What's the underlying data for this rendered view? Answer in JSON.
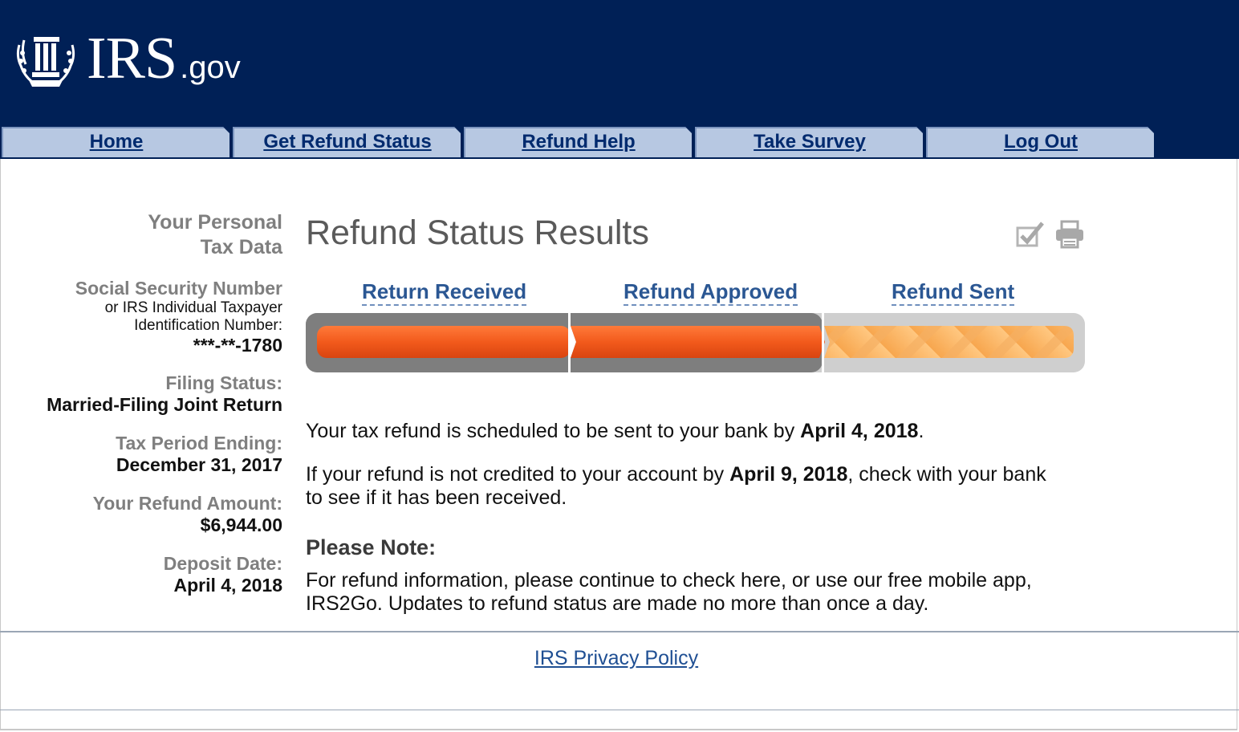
{
  "header": {
    "logo_main": "IRS",
    "logo_suffix": ".gov",
    "logo_icon": "irs-eagle-icon"
  },
  "nav": [
    {
      "label": "Home"
    },
    {
      "label": "Get Refund Status"
    },
    {
      "label": "Refund Help"
    },
    {
      "label": "Take Survey"
    },
    {
      "label": "Log Out"
    }
  ],
  "sidebar": {
    "heading_line1": "Your Personal",
    "heading_line2": "Tax Data",
    "ssn_label": "Social Security Number",
    "ssn_sub1": "or IRS Individual Taxpayer",
    "ssn_sub2": "Identification Number:",
    "ssn_value": "***-**-1780",
    "filing_label": "Filing Status:",
    "filing_value": "Married-Filing Joint Return",
    "period_label": "Tax Period Ending:",
    "period_value": "December 31, 2017",
    "refund_label": "Your Refund Amount:",
    "refund_value": "$6,944.00",
    "deposit_label": "Deposit Date:",
    "deposit_value": "April 4, 2018"
  },
  "main": {
    "title": "Refund Status Results",
    "tools": {
      "check_icon": "checkmark-icon",
      "print_icon": "printer-icon"
    },
    "steps": [
      {
        "label": "Return Received",
        "status": "complete"
      },
      {
        "label": "Refund Approved",
        "status": "complete"
      },
      {
        "label": "Refund Sent",
        "status": "in-progress"
      }
    ],
    "progress_fraction": 0.667,
    "colors": {
      "complete": "#f05a1a",
      "pending": "#f9b261",
      "track": "#8d8d8d",
      "header": "#002056",
      "nav_tab": "#b7c8e2"
    },
    "msg1_pre": "Your tax refund is scheduled to be sent to your bank by ",
    "msg1_date": "April 4, 2018",
    "msg1_post": ".",
    "msg2_pre": "If your refund is not credited to your account by ",
    "msg2_date": "April 9, 2018",
    "msg2_post": ", check with your bank",
    "msg2_line2": "to see if it has been received.",
    "note_heading": "Please Note:",
    "note_line1": "For refund information, please continue to check here, or use our free mobile app,",
    "note_line2": "IRS2Go. Updates to refund status are made no more than once a day."
  },
  "footer": {
    "privacy_link": "IRS Privacy Policy"
  }
}
